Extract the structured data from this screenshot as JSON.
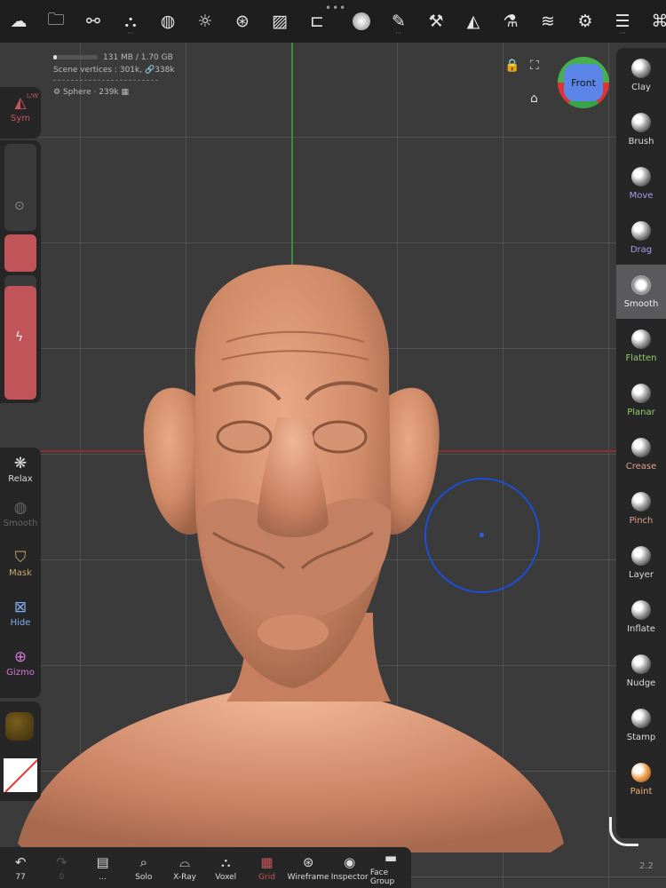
{
  "stats": {
    "memory": "131 MB / 1.70 GB",
    "memory_fraction": 0.08,
    "vertices_label": "Scene vertices :",
    "vertices": "301k",
    "vertices_linked": "338k",
    "object": "Sphere · 239k"
  },
  "viewcube": {
    "face": "Front"
  },
  "left": {
    "sym_hint": "L/W",
    "sym": "Sym",
    "relax": "Relax",
    "smooth": "Smooth",
    "mask": "Mask",
    "hide": "Hide",
    "gizmo": "Gizmo",
    "slider_color": "#c05458"
  },
  "tools": [
    {
      "label": "Clay",
      "color": "#dddddd"
    },
    {
      "label": "Brush",
      "color": "#dddddd"
    },
    {
      "label": "Move",
      "color": "#a89cf0"
    },
    {
      "label": "Drag",
      "color": "#a89cf0"
    },
    {
      "label": "Smooth",
      "color": "#eeeeee"
    },
    {
      "label": "Flatten",
      "color": "#8fd16a"
    },
    {
      "label": "Planar",
      "color": "#8fd16a"
    },
    {
      "label": "Crease",
      "color": "#e0a08c"
    },
    {
      "label": "Pinch",
      "color": "#e0a08c"
    },
    {
      "label": "Layer",
      "color": "#dddddd"
    },
    {
      "label": "Inflate",
      "color": "#dddddd"
    },
    {
      "label": "Nudge",
      "color": "#dddddd"
    },
    {
      "label": "Stamp",
      "color": "#dddddd"
    },
    {
      "label": "Paint",
      "color": "#f0b27a"
    }
  ],
  "bottom": {
    "undo_count": "77",
    "redo_count": "0",
    "more": "...",
    "solo": "Solo",
    "xray": "X-Ray",
    "voxel": "Voxel",
    "grid": "Grid",
    "wireframe": "Wireframe",
    "inspector": "Inspector",
    "facegroup": "Face Group"
  },
  "version": "2.2"
}
